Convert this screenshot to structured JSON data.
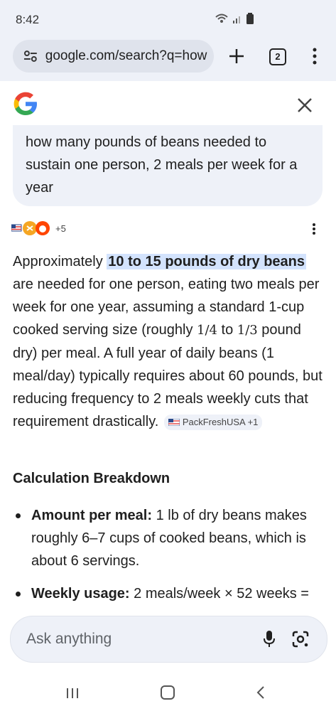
{
  "status": {
    "time": "8:42"
  },
  "browser": {
    "url": "google.com/search?q=how",
    "tab_count": "2"
  },
  "query": {
    "text": "how many pounds of beans needed to sustain one person, 2 meals per week for a year"
  },
  "sources": {
    "count_label": "+5"
  },
  "answer": {
    "intro": "Approximately ",
    "highlight": "10 to 15 pounds of dry beans",
    "p1": " are needed for one person, eating two meals per week for one year, assuming a standard 1-cup cooked serving size (roughly ",
    "frac1": "1/4",
    "p2": " to ",
    "frac2": "1/3",
    "p3": " pound dry) per meal. A full year of daily beans (1 meal/day) typically requires about 60 pounds, but reducing frequency to 2 meals weekly cuts that requirement drastically.",
    "citation": "PackFreshUSA +1"
  },
  "section": {
    "heading": "Calculation Breakdown",
    "bullets": [
      {
        "label": "Amount per meal:",
        "text": " 1 lb of dry beans makes roughly 6–7 cups of cooked beans, which is about 6 servings."
      },
      {
        "label": "Weekly usage:",
        "text": " 2 meals/week × 52 weeks ="
      }
    ]
  },
  "ask": {
    "placeholder": "Ask anything"
  },
  "colors": {
    "highlight": "#d3e3fd",
    "bar_bg": "#eef1f8"
  }
}
